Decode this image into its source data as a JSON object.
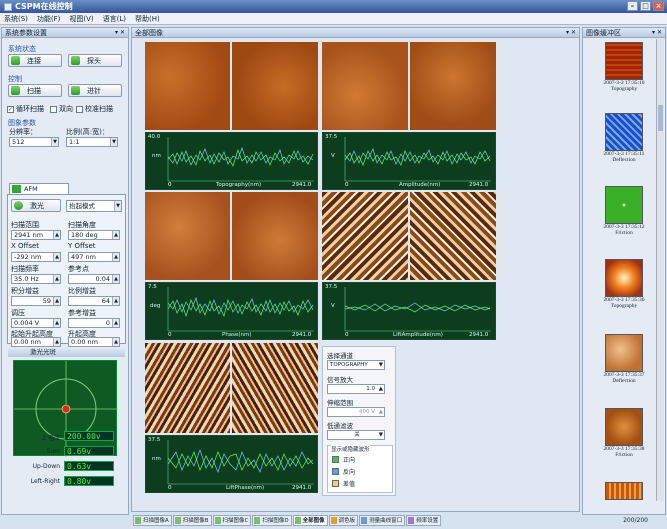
{
  "window": {
    "title": "CSPM在线控制"
  },
  "menu": [
    "系统(S)",
    "功能(F)",
    "视图(V)",
    "语言(L)",
    "帮助(H)"
  ],
  "left": {
    "panel_title": "系统参数设置",
    "sys_state": "系统状态",
    "connect": "连接",
    "probe": "探头",
    "control": "控制",
    "scan": "扫描",
    "approach": "进针",
    "loop_scan": "循环扫描",
    "bidirectional": "双向",
    "calibrate_scan": "校准扫描",
    "image_params": "图象参数",
    "resolution_label": "分辨率：",
    "resolution_value": "512",
    "ratio_label": "比例(高:宽)：",
    "ratio_value": "1:1",
    "afm_tab": "AFM",
    "laser": "激光",
    "mode": "抬起模式",
    "scan_range_label": "扫描范围",
    "scan_range": "2941 nm",
    "scan_angle_label": "扫描角度",
    "scan_angle": "180 deg",
    "x_offset_label": "X Offset",
    "x_offset": "-292 nm",
    "y_offset_label": "Y Offset",
    "y_offset": "497 nm",
    "scan_freq_label": "扫描频率",
    "scan_freq": "35.0 Hz",
    "setpoint_label": "参考点",
    "setpoint": "0.04",
    "igain_label": "积分增益",
    "igain": "59",
    "pgain_label": "比例增益",
    "pgain": "64",
    "amp_label": "调压",
    "amp": "0.004 V",
    "ref_gain_label": "参考增益",
    "ref_gain": "0",
    "lift_start_label": "起始升起高度",
    "lift_start": "0.00 nm",
    "lift_label": "升起高度",
    "lift": "0.00 nm",
    "laser_spot": "激光光斑",
    "z_voltage_label": "Z 电压",
    "z_voltage": "200.00v",
    "sum_label": "Sum",
    "sum": "0.69v",
    "updown_label": "Up-Down",
    "updown": "0.63v",
    "leftright_label": "Left-Right",
    "leftright": "0.80v"
  },
  "center": {
    "panel_title": "全部图像",
    "plots": [
      {
        "title": "Topography(nm)",
        "ymax": "40.0",
        "yunit": "nm",
        "xmin": "0",
        "xmax": "2941.0"
      },
      {
        "title": "Amplitude(nm)",
        "ymax": "37.5",
        "yunit": "V",
        "xmin": "0",
        "xmax": "2941.0"
      },
      {
        "title": "Phase(nm)",
        "ymax": "7.5",
        "yunit": "deg",
        "xmin": "0",
        "xmax": "2941.0"
      },
      {
        "title": "LiftAmplitude(nm)",
        "ymax": "37.5",
        "yunit": "V",
        "xmin": "0",
        "xmax": "2941.0"
      },
      {
        "title": "LiftPhase(nm)",
        "ymax": "37.5",
        "yunit": "nm",
        "xmin": "0",
        "xmax": "2941.0"
      }
    ],
    "controls": {
      "channel_label": "选择通道",
      "channel": "TOPOGRAPHY",
      "signal_gain_label": "信号放大",
      "signal_gain": "1.0",
      "stretch_label": "伸缩范围",
      "stretch": "400 V",
      "filter_label": "低通滤波",
      "filter": "关",
      "show_hide_label": "显示或隐藏波形",
      "legend_forward": "正向",
      "legend_reverse": "反向",
      "legend_diff": "差值"
    }
  },
  "right": {
    "panel_title": "图像缓冲区",
    "items": [
      {
        "time": "2007-3-3 17:35:10",
        "type": "Topography"
      },
      {
        "time": "2007-3-3 17:35:11",
        "type": "Deflection"
      },
      {
        "time": "2007-3-3 17:35:12",
        "type": "Friction"
      },
      {
        "time": "2007-3-3 17:35:36",
        "type": "Topography"
      },
      {
        "time": "2007-3-3 17:35:37",
        "type": "Deflection"
      },
      {
        "time": "2007-3-3 17:35:38",
        "type": "Friction"
      }
    ],
    "pager": "200/200"
  },
  "bottom_tabs": [
    "扫描图像A",
    "扫描图像B",
    "扫描图像C",
    "扫描图像D",
    "全部图像",
    "调色板",
    "测量曲线窗口",
    "频率设置"
  ]
}
